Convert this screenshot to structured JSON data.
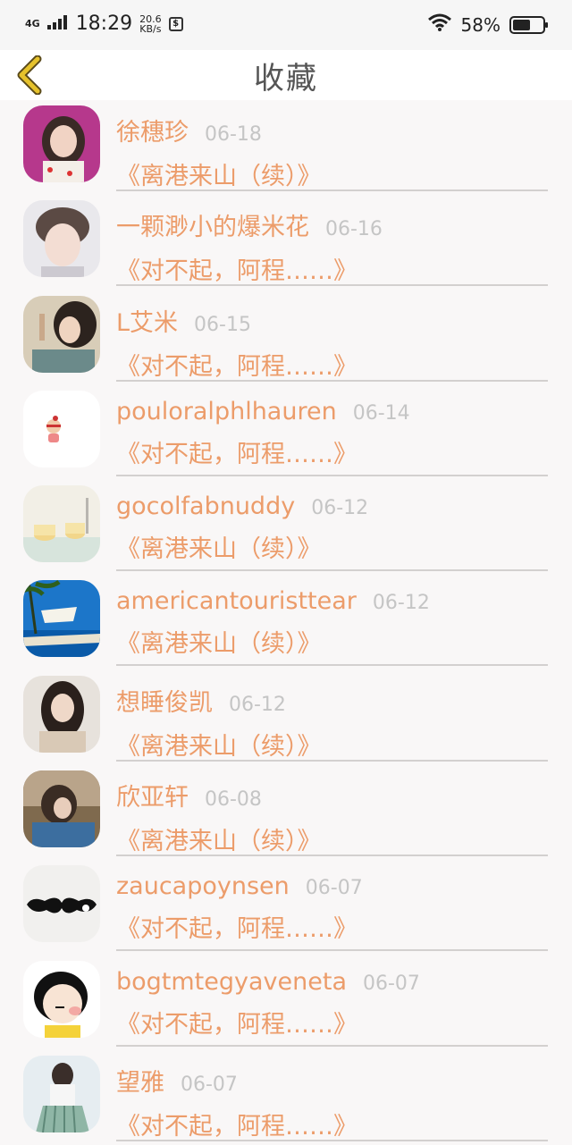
{
  "status": {
    "network": "4G",
    "time": "18:29",
    "speed_value": "20.6",
    "speed_unit": "KB/s",
    "battery": "58%",
    "battery_level": 0.58
  },
  "header": {
    "title": "收藏",
    "back_icon": "chevron-left-icon",
    "accent": "#e6c22c"
  },
  "colors": {
    "name": "#ec9c6a",
    "date": "#c5c5c5"
  },
  "favorites": [
    {
      "name": "徐穗珍",
      "date": "06-18",
      "story": "《离港来山（续）》"
    },
    {
      "name": "一颗渺小的爆米花",
      "date": "06-16",
      "story": "《对不起，阿程……》"
    },
    {
      "name": "L艾米",
      "date": "06-15",
      "story": "《对不起，阿程……》"
    },
    {
      "name": "pouloralphlhauren",
      "date": "06-14",
      "story": "《对不起，阿程……》"
    },
    {
      "name": "gocolfabnuddy",
      "date": "06-12",
      "story": "《离港来山（续）》"
    },
    {
      "name": "americantouristtear",
      "date": "06-12",
      "story": "《离港来山（续）》"
    },
    {
      "name": "想睡俊凯",
      "date": "06-12",
      "story": "《离港来山（续）》"
    },
    {
      "name": "欣亚轩",
      "date": "06-08",
      "story": "《离港来山（续）》"
    },
    {
      "name": "zaucapoynsen",
      "date": "06-07",
      "story": "《对不起，阿程……》"
    },
    {
      "name": "bogtmtegyaveneta",
      "date": "06-07",
      "story": "《对不起，阿程……》"
    },
    {
      "name": "望雅",
      "date": "06-07",
      "story": "《对不起，阿程……》"
    }
  ]
}
